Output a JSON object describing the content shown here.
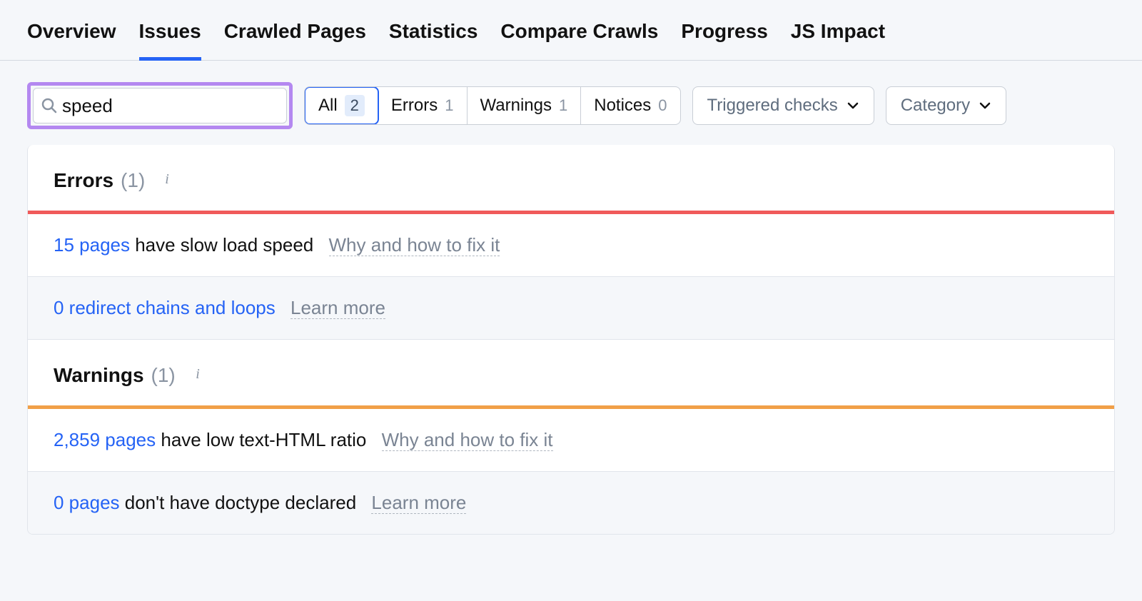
{
  "tabs": {
    "overview": "Overview",
    "issues": "Issues",
    "crawled_pages": "Crawled Pages",
    "statistics": "Statistics",
    "compare_crawls": "Compare Crawls",
    "progress": "Progress",
    "js_impact": "JS Impact"
  },
  "filters": {
    "search_value": "speed",
    "all_label": "All",
    "all_count": "2",
    "errors_label": "Errors",
    "errors_count": "1",
    "warnings_label": "Warnings",
    "warnings_count": "1",
    "notices_label": "Notices",
    "notices_count": "0",
    "triggered_checks_label": "Triggered checks",
    "category_label": "Category"
  },
  "sections": {
    "errors": {
      "title": "Errors",
      "count": "(1)",
      "rows": [
        {
          "link": "15 pages",
          "text": " have slow load speed",
          "hint": "Why and how to fix it",
          "dim": false
        },
        {
          "link": "0 redirect chains and loops",
          "text": "",
          "hint": "Learn more",
          "dim": true
        }
      ]
    },
    "warnings": {
      "title": "Warnings",
      "count": "(1)",
      "rows": [
        {
          "link": "2,859 pages",
          "text": " have low text-HTML ratio",
          "hint": "Why and how to fix it",
          "dim": false
        },
        {
          "link": "0 pages",
          "text": " don't have doctype declared",
          "hint": "Learn more",
          "dim": true
        }
      ]
    }
  }
}
